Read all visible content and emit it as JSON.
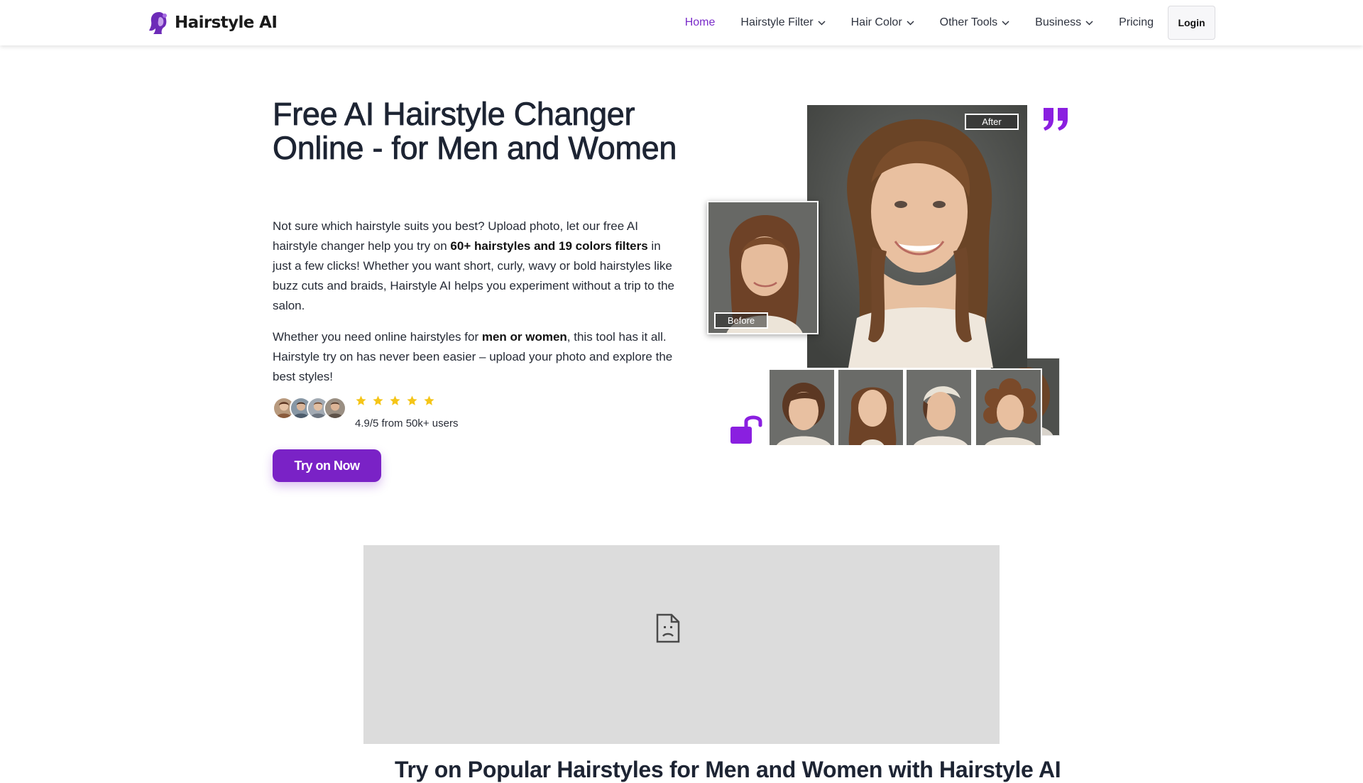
{
  "brand": {
    "name": "Hairstyle AI",
    "accent": "#7a22c6",
    "icon": "woman-silhouette-logo-icon"
  },
  "nav": {
    "items": [
      {
        "label": "Home",
        "active": true,
        "dropdown": false
      },
      {
        "label": "Hairstyle Filter",
        "active": false,
        "dropdown": true
      },
      {
        "label": "Hair Color",
        "active": false,
        "dropdown": true
      },
      {
        "label": "Other Tools",
        "active": false,
        "dropdown": true
      },
      {
        "label": "Business",
        "active": false,
        "dropdown": true
      },
      {
        "label": "Pricing",
        "active": false,
        "dropdown": false
      }
    ],
    "login": "Login"
  },
  "hero": {
    "title": "Free AI Hairstyle Changer Online - for Men and Women",
    "p1": {
      "before": "Not sure which hairstyle suits you best? Upload photo, let our free AI hairstyle changer help you try on ",
      "bold": "60+ hairstyles and 19 colors filters",
      "after": " in just a few clicks! Whether you want short, curly, wavy or bold hairstyles like buzz cuts and braids, Hairstyle AI helps you experiment without a trip to the salon."
    },
    "p2": {
      "before": "Whether you need online hairstyles for ",
      "bold": "men or women",
      "after": ", this tool has it all. Hairstyle try on has never been easier – upload your photo and explore the best styles!"
    },
    "stars": 5,
    "rating_text": "4.9/5 from 50k+ users",
    "cta": "Try on Now"
  },
  "visual": {
    "after_label": "After",
    "before_label": "Before",
    "quote_icon": "quote-icon",
    "lock_icon": "unlock-icon"
  },
  "video": {
    "icon": "broken-file-icon"
  },
  "section": {
    "heading": "Try on Popular Hairstyles for Men and Women with Hairstyle AI"
  }
}
